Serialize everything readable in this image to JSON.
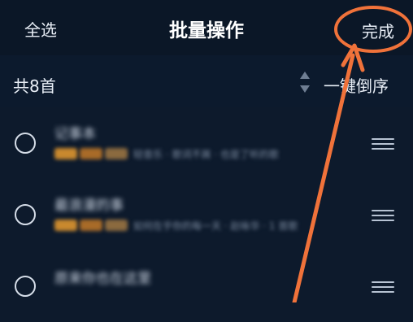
{
  "header": {
    "select_all_label": "全选",
    "title": "批量操作",
    "done_label": "完成"
  },
  "toolbar": {
    "count_label": "共8首",
    "sort_icon": "sort-updown-icon",
    "reverse_label": "一键倒序"
  },
  "songs": [
    {
      "title": "记事本",
      "subtitle": "轻音乐 · 歌词不屑 · 也是了听的歌"
    },
    {
      "title": "最浪漫的事",
      "subtitle": "如何在乎你的每一天 · 赵咏华 · 1 首歌"
    },
    {
      "title": "原来你也在这里",
      "subtitle": ""
    }
  ],
  "colors": {
    "background": "#0d1a2c",
    "annotation": "#f0723a"
  }
}
